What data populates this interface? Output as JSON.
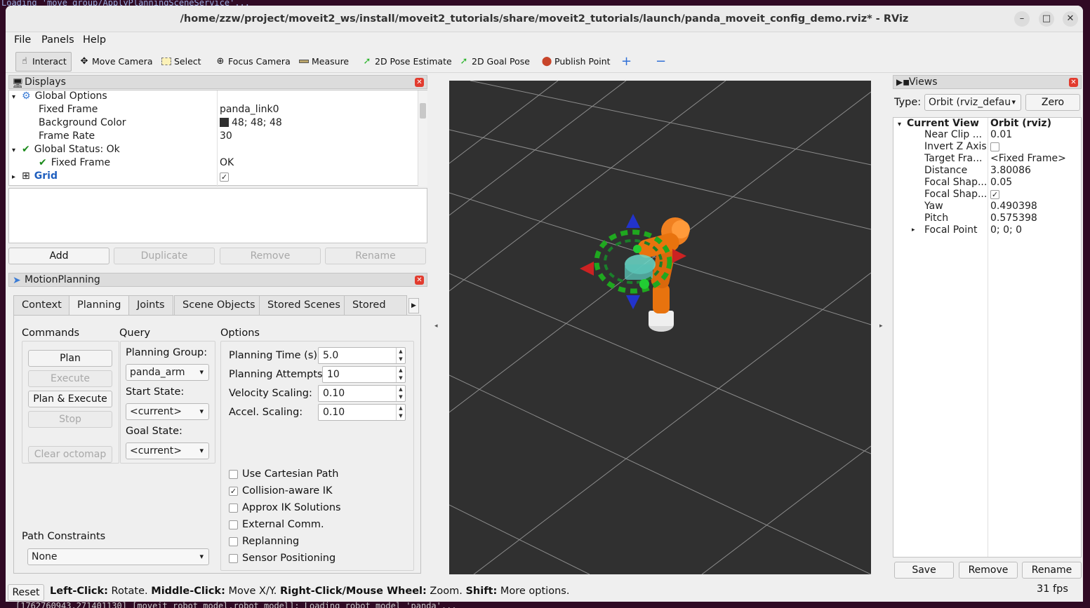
{
  "terminal": {
    "top_text": "Loading 'move_group/ApplyPlanningSceneService'...",
    "bottom_text": "[1762760943.271401130] [moveit_robot_model.robot_model]: Loading robot model 'panda'..."
  },
  "window": {
    "title": "/home/zzw/project/moveit2_ws/install/moveit2_tutorials/share/moveit2_tutorials/launch/panda_moveit_config_demo.rviz* - RViz",
    "minimize": "–",
    "maximize": "□",
    "close": "✕"
  },
  "menu": {
    "file": "File",
    "panels": "Panels",
    "help": "Help"
  },
  "toolbar": {
    "interact": "Interact",
    "move_camera": "Move Camera",
    "select": "Select",
    "focus_camera": "Focus Camera",
    "measure": "Measure",
    "pose_estimate": "2D Pose Estimate",
    "goal_pose": "2D Goal Pose",
    "publish_point": "Publish Point",
    "add_tool": "+",
    "remove_tool": "−"
  },
  "displays": {
    "title": "Displays",
    "rows": {
      "global_options": "Global Options",
      "fixed_frame_label": "Fixed Frame",
      "fixed_frame_value": "panda_link0",
      "bg_color_label": "Background Color",
      "bg_color_value": "48; 48; 48",
      "frame_rate_label": "Frame Rate",
      "frame_rate_value": "30",
      "global_status": "Global Status: Ok",
      "status_fixed_frame": "Fixed Frame",
      "status_fixed_frame_value": "OK",
      "grid": "Grid"
    },
    "buttons": {
      "add": "Add",
      "duplicate": "Duplicate",
      "remove": "Remove",
      "rename": "Rename"
    }
  },
  "motion_planning": {
    "title": "MotionPlanning",
    "tabs": [
      "Context",
      "Planning",
      "Joints",
      "Scene Objects",
      "Stored Scenes",
      "Stored Sta"
    ],
    "commands_label": "Commands",
    "query_label": "Query",
    "options_label": "Options",
    "buttons": {
      "plan": "Plan",
      "execute": "Execute",
      "plan_execute": "Plan & Execute",
      "stop": "Stop",
      "clear_octomap": "Clear octomap"
    },
    "planning_group_label": "Planning Group:",
    "planning_group_value": "panda_arm",
    "start_state_label": "Start State:",
    "start_state_value": "<current>",
    "goal_state_label": "Goal State:",
    "goal_state_value": "<current>",
    "planning_time_label": "Planning Time (s):",
    "planning_time_value": "5.0",
    "planning_attempts_label": "Planning Attempts:",
    "planning_attempts_value": "10",
    "velocity_scaling_label": "Velocity Scaling:",
    "velocity_scaling_value": "0.10",
    "accel_scaling_label": "Accel. Scaling:",
    "accel_scaling_value": "0.10",
    "checkboxes": [
      {
        "label": "Use Cartesian Path",
        "checked": false
      },
      {
        "label": "Collision-aware IK",
        "checked": true
      },
      {
        "label": "Approx IK Solutions",
        "checked": false
      },
      {
        "label": "External Comm.",
        "checked": false
      },
      {
        "label": "Replanning",
        "checked": false
      },
      {
        "label": "Sensor Positioning",
        "checked": false
      }
    ],
    "path_constraints_label": "Path Constraints",
    "path_constraints_value": "None"
  },
  "views": {
    "title": "Views",
    "type_label": "Type:",
    "type_value": "Orbit (rviz_defau",
    "zero": "Zero",
    "current_view": "Current View",
    "current_view_type": "Orbit (rviz)",
    "props": [
      {
        "name": "Near Clip ...",
        "value": "0.01"
      },
      {
        "name": "Invert Z Axis",
        "value": ""
      },
      {
        "name": "Target Fra...",
        "value": "<Fixed Frame>"
      },
      {
        "name": "Distance",
        "value": "3.80086"
      },
      {
        "name": "Focal Shap...",
        "value": "0.05"
      },
      {
        "name": "Focal Shap...",
        "value": "✓"
      },
      {
        "name": "Yaw",
        "value": "0.490398"
      },
      {
        "name": "Pitch",
        "value": "0.575398"
      },
      {
        "name": "Focal Point",
        "value": "0; 0; 0"
      }
    ],
    "buttons": {
      "save": "Save",
      "remove": "Remove",
      "rename": "Rename"
    }
  },
  "status": {
    "reset": "Reset",
    "left_click": "Left-Click:",
    "left_click_desc": " Rotate. ",
    "middle_click": "Middle-Click:",
    "middle_click_desc": " Move X/Y. ",
    "right_click": "Right-Click/Mouse Wheel:",
    "right_click_desc": " Zoom. ",
    "shift": "Shift:",
    "shift_desc": " More options.",
    "fps": "31 fps"
  },
  "colors": {
    "viewport_bg": "#303030",
    "accent": "#1f5fbf",
    "robot": "#e8730e"
  }
}
